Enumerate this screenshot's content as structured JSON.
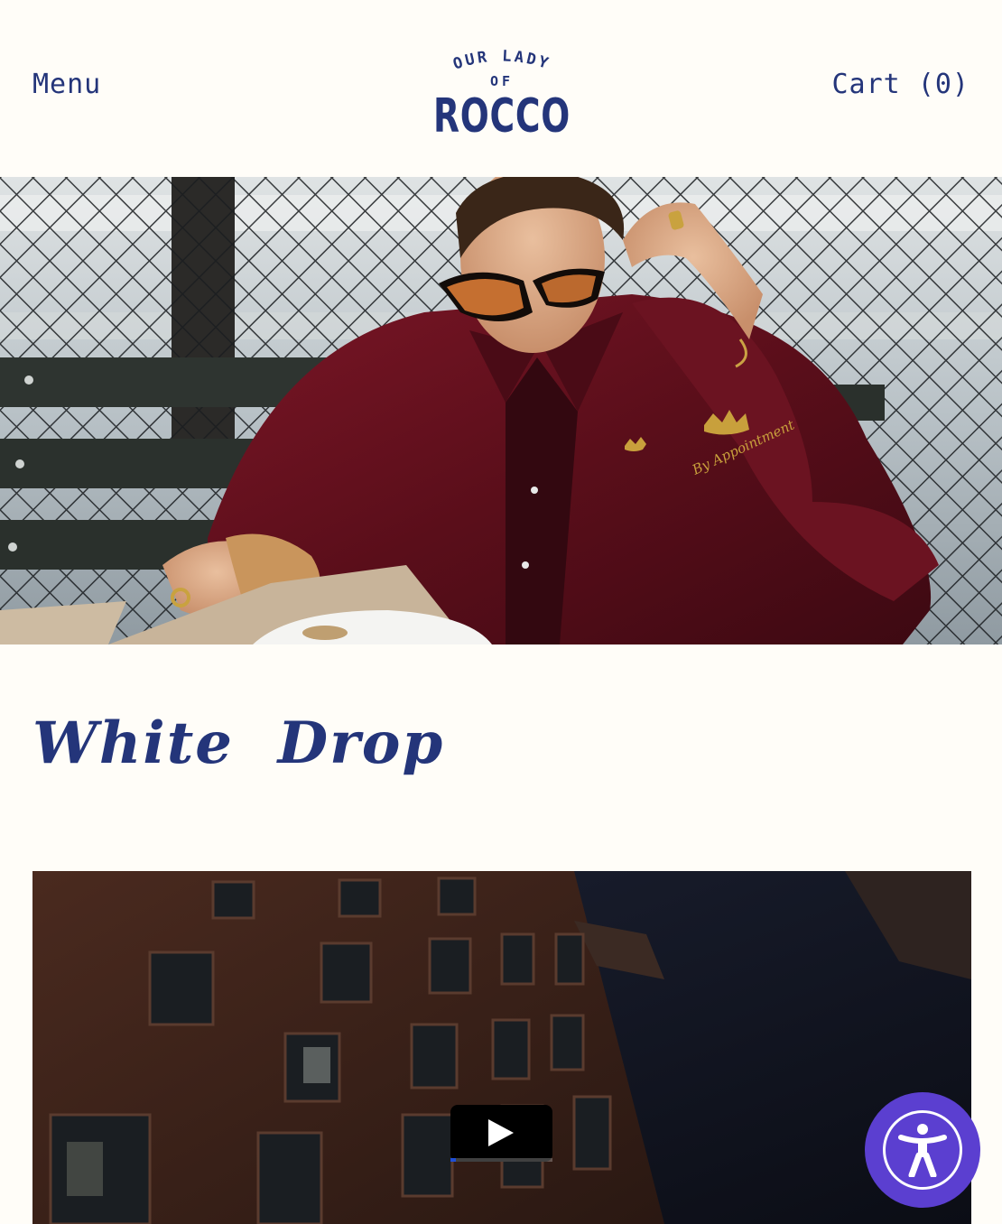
{
  "header": {
    "menu_label": "Menu",
    "cart_label": "Cart (0)",
    "logo": {
      "line1": "OUR LADY",
      "line2": "OF",
      "line3": "ROCCO"
    }
  },
  "hero": {
    "image_icon": "hero-photo",
    "jacket_embroidery": "By Appointment"
  },
  "main": {
    "title": "White  Drop"
  },
  "video": {
    "play_icon": "play-icon",
    "progress": 0.05
  },
  "accessibility": {
    "icon": "accessibility-icon"
  },
  "colors": {
    "brand_navy": "#24357a",
    "background": "#fffdf8",
    "accessibility_purple": "#5b3fd0"
  }
}
